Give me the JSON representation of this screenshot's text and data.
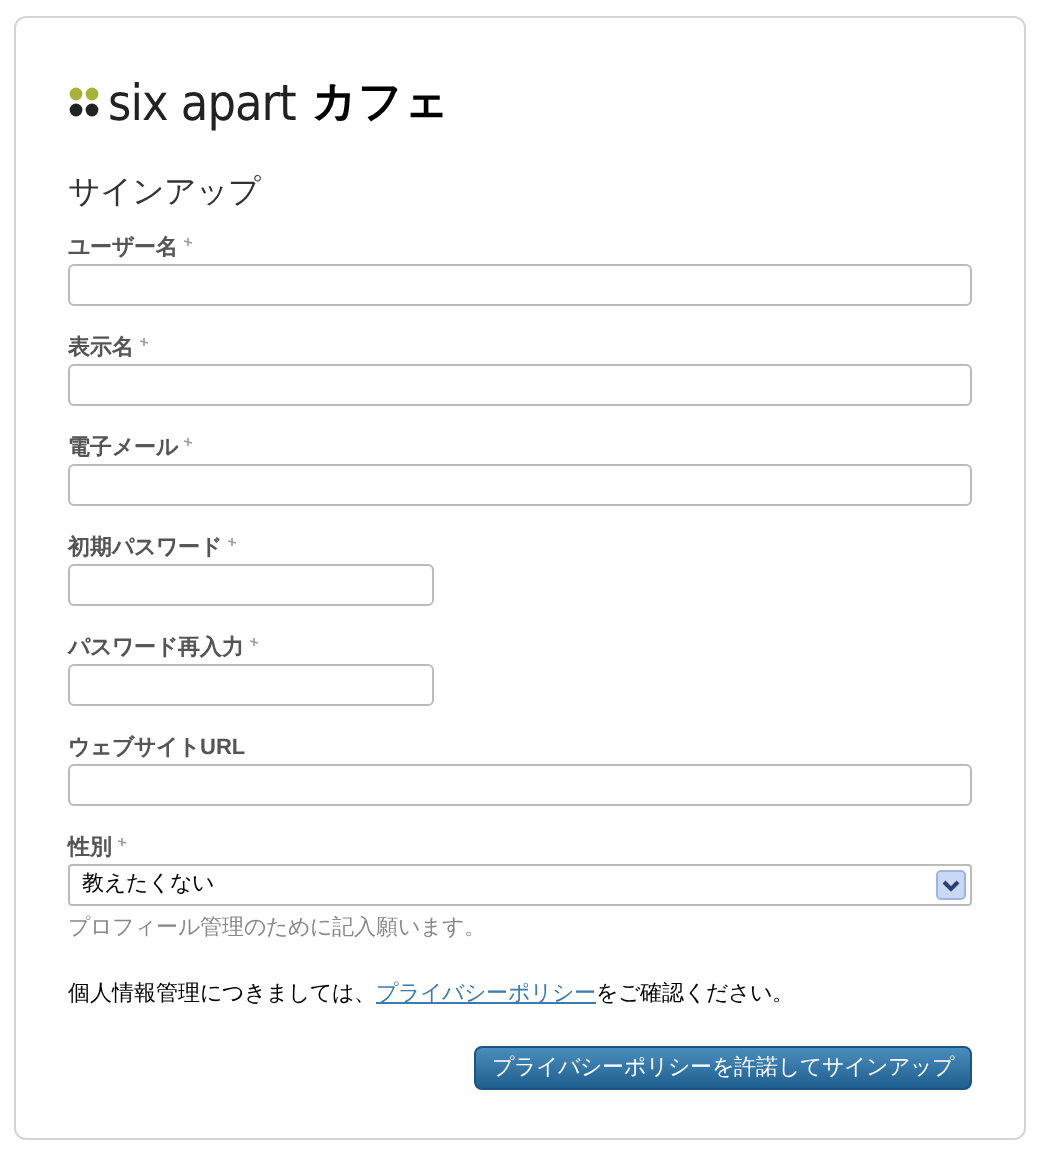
{
  "logo": {
    "brand": "six apart",
    "suffix": "カフェ"
  },
  "heading": "サインアップ",
  "fields": [
    {
      "label": "ユーザー名",
      "required": true,
      "kind": "wide"
    },
    {
      "label": "表示名",
      "required": true,
      "kind": "wide"
    },
    {
      "label": "電子メール",
      "required": true,
      "kind": "wide"
    },
    {
      "label": "初期パスワード",
      "required": true,
      "kind": "short"
    },
    {
      "label": "パスワード再入力",
      "required": true,
      "kind": "short"
    },
    {
      "label": "ウェブサイトURL",
      "required": false,
      "kind": "wide"
    },
    {
      "label": "性別",
      "required": true,
      "kind": "select",
      "value": "教えたくない",
      "hint": "プロフィール管理のために記入願います。"
    }
  ],
  "notice": {
    "before": "個人情報管理につきましては、",
    "link": "プライバシーポリシー",
    "after": "をご確認ください。"
  },
  "submit": "プライバシーポリシーを許諾してサインアップ"
}
